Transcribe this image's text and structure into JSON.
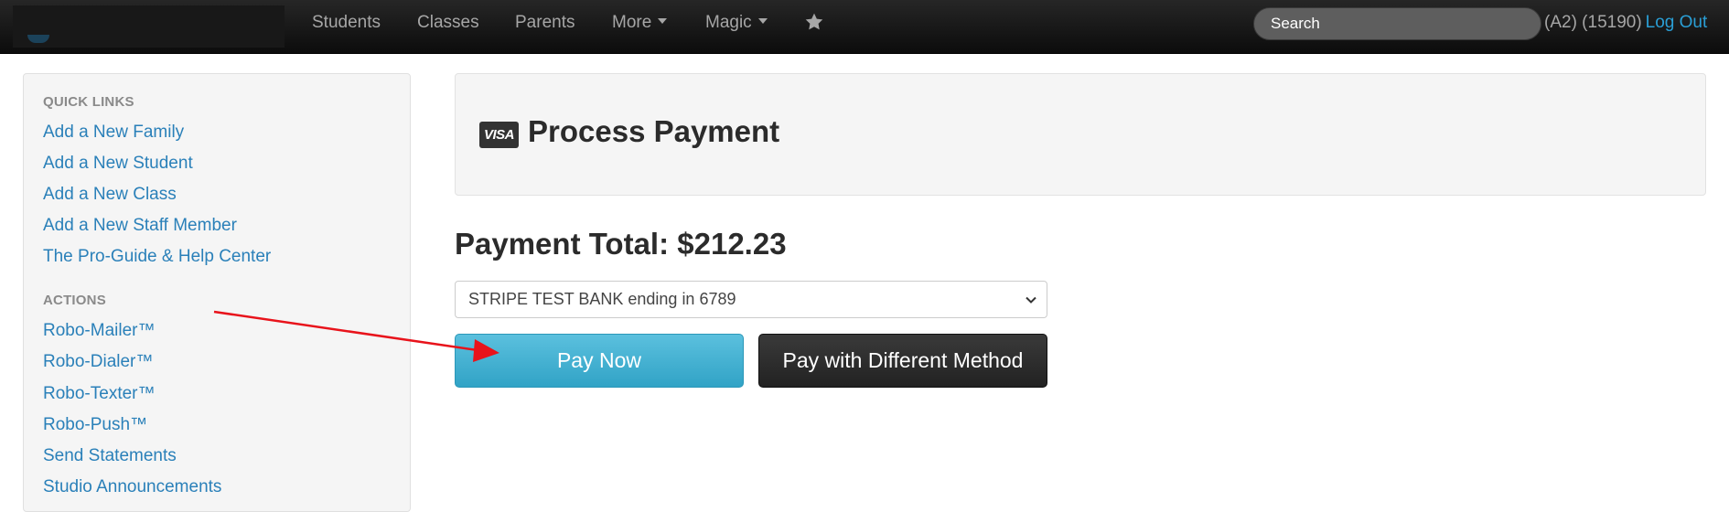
{
  "navbar": {
    "items": [
      {
        "label": "Students"
      },
      {
        "label": "Classes"
      },
      {
        "label": "Parents"
      },
      {
        "label": "More"
      },
      {
        "label": "Magic"
      }
    ],
    "search_placeholder": "Search",
    "user_info": "(A2) (15190)",
    "logout_label": "Log Out",
    "star_icon": "star-icon"
  },
  "sidebar": {
    "quick_links_header": "QUICK LINKS",
    "quick_links": [
      {
        "label": "Add a New Family"
      },
      {
        "label": "Add a New Student"
      },
      {
        "label": "Add a New Class"
      },
      {
        "label": "Add a New Staff Member"
      },
      {
        "label": "The Pro-Guide & Help Center"
      }
    ],
    "actions_header": "ACTIONS",
    "actions": [
      {
        "label": "Robo-Mailer™"
      },
      {
        "label": "Robo-Dialer™"
      },
      {
        "label": "Robo-Texter™"
      },
      {
        "label": "Robo-Push™"
      },
      {
        "label": "Send Statements"
      },
      {
        "label": "Studio Announcements"
      }
    ]
  },
  "main": {
    "visa_label": "VISA",
    "title": "Process Payment",
    "payment_total": "Payment Total: $212.23",
    "payment_method": "STRIPE TEST BANK ending in 6789",
    "pay_now_label": "Pay Now",
    "pay_different_label": "Pay with Different Method"
  },
  "colors": {
    "navbar_bg": "#1a1a1a",
    "link": "#2a80b9",
    "pay_button": "#45b3d6",
    "alt_button": "#2e2e2e",
    "annotation_arrow": "#e8131b"
  }
}
